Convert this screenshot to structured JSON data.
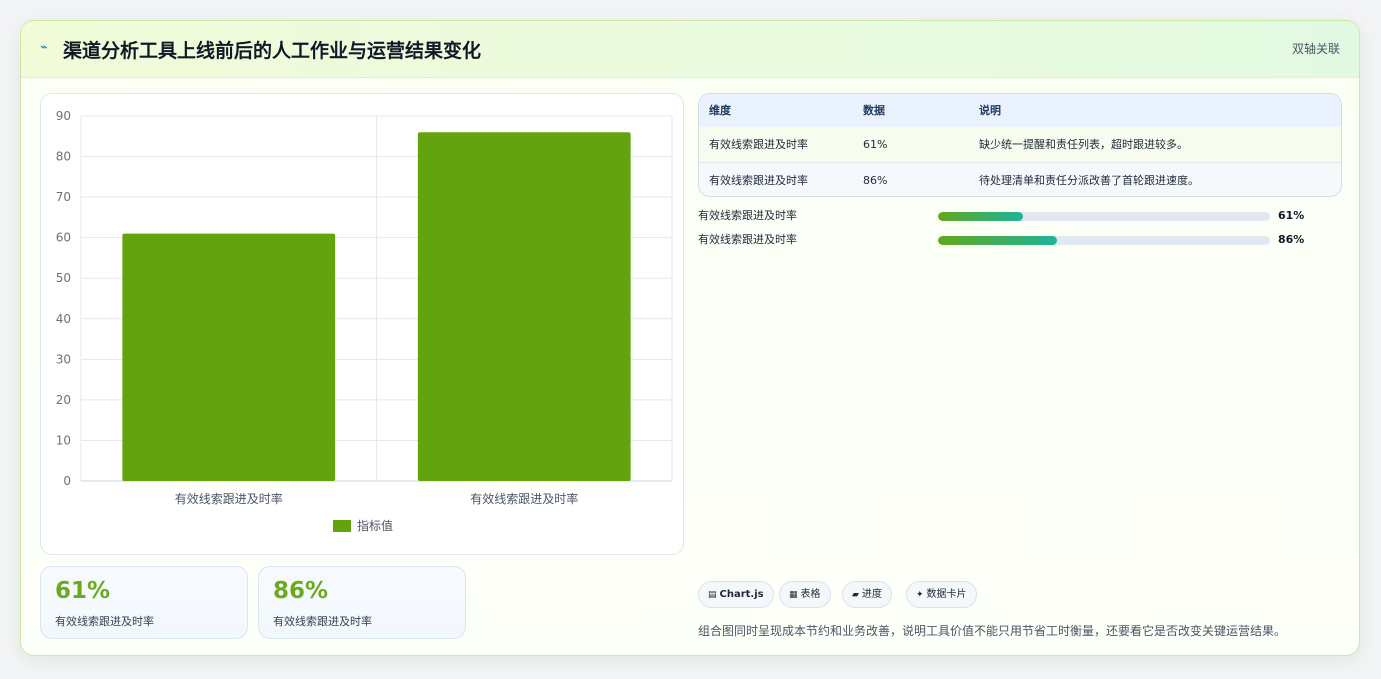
{
  "header": {
    "icon": "lightning-icon",
    "title": "渠道分析工具上线前后的人工作业与运营结果变化",
    "tag": "双轴关联"
  },
  "chart_data": {
    "type": "bar",
    "categories": [
      "有效线索跟进及时率",
      "有效线索跟进及时率"
    ],
    "series": [
      {
        "name": "指标值",
        "values": [
          61,
          86
        ],
        "color": "#63a30e"
      }
    ],
    "ylim": [
      0,
      90
    ],
    "yticks": [
      0,
      10,
      20,
      30,
      40,
      50,
      60,
      70,
      80,
      90
    ],
    "legend": "bottom",
    "grid": true
  },
  "stats": [
    {
      "value": "61%",
      "label": "有效线索跟进及时率"
    },
    {
      "value": "86%",
      "label": "有效线索跟进及时率"
    }
  ],
  "table": {
    "headers": [
      "维度",
      "数据",
      "说明"
    ],
    "rows": [
      [
        "有效线索跟进及时率",
        "61%",
        "缺少统一提醒和责任列表，超时跟进较多。"
      ],
      [
        "有效线索跟进及时率",
        "86%",
        "待处理清单和责任分派改善了首轮跟进速度。"
      ]
    ]
  },
  "progress": [
    {
      "label": "有效线索跟进及时率",
      "value_text": "61%",
      "fill": 0.255
    },
    {
      "label": "有效线索跟进及时率",
      "value_text": "86%",
      "fill": 0.358
    }
  ],
  "chips": [
    {
      "icon": "chart-icon",
      "glyph": "▤",
      "label": "Chart.js"
    },
    {
      "icon": "table-icon",
      "glyph": "▦",
      "label": "表格"
    },
    {
      "icon": "progress-icon",
      "glyph": "▰",
      "label": "进度"
    },
    {
      "icon": "sparkle-icon",
      "glyph": "✦",
      "label": "数据卡片"
    }
  ],
  "note": "组合图同时呈现成本节约和业务改善，说明工具价值不能只用节省工时衡量，还要看它是否改变关键运营结果。",
  "colors": {
    "bar": "#63a30e",
    "accent": "#6aaa1c",
    "progress_start": "#63a61c",
    "progress_end": "#1db59a"
  }
}
